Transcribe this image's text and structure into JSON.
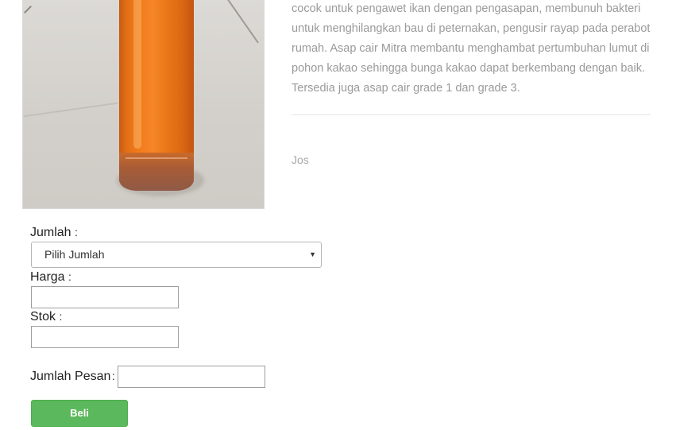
{
  "product": {
    "description": "cocok untuk pengawet ikan dengan pengasapan, membunuh bakteri untuk menghilangkan bau di peternakan, pengusir rayap pada perabot rumah. Asap cair Mitra membantu menghambat pertumbuhan lumut di pohon kakao sehingga bunga kakao dapat berkembang dengan baik. Tersedia juga asap cair grade 1 dan grade 3.",
    "review_author": "Jos"
  },
  "form": {
    "jumlah_label": "Jumlah",
    "jumlah_selected": "Pilih Jumlah",
    "harga_label": "Harga",
    "stok_label": "Stok",
    "jumlah_pesan_label": "Jumlah Pesan",
    "colon": ":",
    "buy_label": "Beli"
  },
  "colors": {
    "buy_button": "#5cb85c"
  }
}
